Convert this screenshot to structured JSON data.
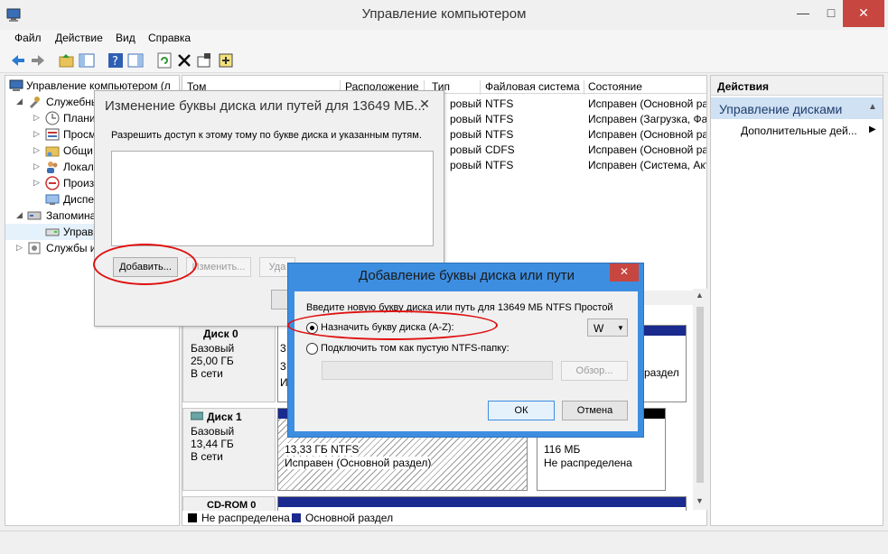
{
  "window": {
    "title": "Управление компьютером",
    "min": "—",
    "max": "□",
    "close": "✕"
  },
  "menu": [
    "Файл",
    "Действие",
    "Вид",
    "Справка"
  ],
  "tree": [
    {
      "label": "Управление компьютером (л",
      "indent": 0
    },
    {
      "label": "Служебные",
      "indent": 1
    },
    {
      "label": "Плани",
      "indent": 2
    },
    {
      "label": "Просм",
      "indent": 2
    },
    {
      "label": "Общи",
      "indent": 2
    },
    {
      "label": "Локал",
      "indent": 2
    },
    {
      "label": "Произ",
      "indent": 2
    },
    {
      "label": "Диспе",
      "indent": 2
    },
    {
      "label": "Запомина",
      "indent": 1
    },
    {
      "label": "Управ",
      "indent": 2
    },
    {
      "label": "Службы и",
      "indent": 1
    }
  ],
  "volumes": {
    "columns": [
      "Том",
      "Расположение",
      "Тип",
      "Файловая система",
      "Состояние"
    ],
    "rows": [
      {
        "type": "ровый",
        "fs": "NTFS",
        "status": "Исправен (Основной ра"
      },
      {
        "type": "ровый",
        "fs": "NTFS",
        "status": "Исправен (Загрузка, Фа"
      },
      {
        "type": "ровый",
        "fs": "NTFS",
        "status": "Исправен (Основной ра"
      },
      {
        "type": "ровый",
        "fs": "CDFS",
        "status": "Исправен (Основной ра"
      },
      {
        "type": "ровый",
        "fs": "NTFS",
        "status": "Исправен (Система, Акт"
      }
    ]
  },
  "disks": {
    "disk0": {
      "name": "Диск 0",
      "kind": "Базовый",
      "size": "25,00 ГБ",
      "state": "В сети",
      "part_frag": [
        "3",
        "3",
        "И"
      ],
      "right_text": "раздел"
    },
    "disk1": {
      "name": "Диск 1",
      "kind": "Базовый",
      "size": "13,44 ГБ",
      "state": "В сети",
      "part_size": "13,33 ГБ NTFS",
      "part_status": "Исправен (Основной раздел)",
      "unalloc_size": "116 МБ",
      "unalloc_status": "Не распределена"
    },
    "cdrom": {
      "name": "CD-ROM 0"
    }
  },
  "legend": {
    "unallocated": "Не распределена",
    "primary": "Основной раздел"
  },
  "actions": {
    "header": "Действия",
    "section": "Управление дисками",
    "more": "Дополнительные дей..."
  },
  "dialog1": {
    "title": "Изменение буквы диска или путей для 13649 МБ...",
    "close": "✕",
    "description": "Разрешить доступ к этому тому по букве диска и указанным путям.",
    "add": "Добавить...",
    "change": "Изменить...",
    "remove": "Уда"
  },
  "dialog2": {
    "title": "Добавление буквы диска или пути",
    "close": "✕",
    "description": "Введите новую букву диска или путь для 13649 МБ NTFS Простой",
    "assign_letter": "Назначить букву диска (A-Z):",
    "drive_letter": "W",
    "mount_folder": "Подключить том как пустую NTFS-папку:",
    "browse": "Обзор...",
    "ok": "ОК",
    "cancel": "Отмена"
  },
  "colors": {
    "accent": "#3d8ee1",
    "close_red": "#c7463f",
    "annotation": "#e01010",
    "primary_partition": "#1a2a8e"
  }
}
